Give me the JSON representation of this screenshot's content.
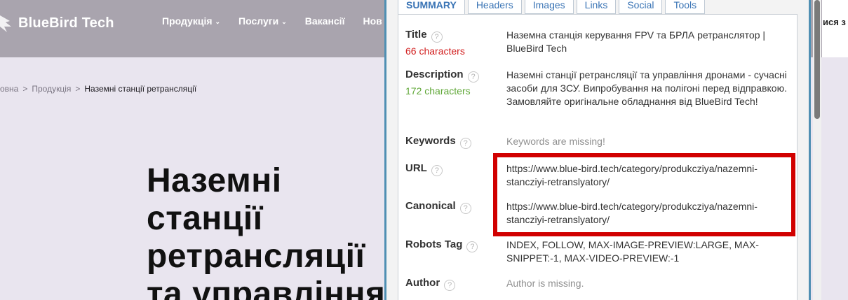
{
  "site": {
    "logo_text": "BlueBird Tech",
    "nav": [
      {
        "label": "Продукція",
        "has_dropdown": true
      },
      {
        "label": "Послуги",
        "has_dropdown": true
      },
      {
        "label": "Вакансії",
        "has_dropdown": false
      },
      {
        "label": "Нов",
        "has_dropdown": false
      }
    ],
    "right_cut_text": "ися з",
    "breadcrumb": {
      "home": "овна",
      "section": "Продукція",
      "current": "Наземні станції ретрансляції",
      "separator": ">"
    },
    "hero_lines": [
      "Наземні",
      "станції",
      "ретрансляції",
      "та управління"
    ]
  },
  "extension": {
    "tabs": [
      "SUMMARY",
      "Headers",
      "Images",
      "Links",
      "Social",
      "Tools"
    ],
    "active_tab": "SUMMARY",
    "rows": {
      "title": {
        "label": "Title",
        "count": "66 characters",
        "value": "Наземна станція керування FPV та БРЛА ретранслятор | BlueBird Tech"
      },
      "description": {
        "label": "Description",
        "count": "172 characters",
        "value": "Наземні станції ретрансляції та управління дронами - сучасні засоби для ЗСУ. Випробування на полігоні перед відправкою. Замовляйте оригінальне обладнання від BlueBird Tech!"
      },
      "keywords": {
        "label": "Keywords",
        "value": "Keywords are missing!"
      },
      "url": {
        "label": "URL",
        "value": "https://www.blue-bird.tech/category/produkcziya/nazemni-stancziyi-retranslyatory/"
      },
      "canonical": {
        "label": "Canonical",
        "value": "https://www.blue-bird.tech/category/produkcziya/nazemni-stancziyi-retranslyatory/"
      },
      "robots": {
        "label": "Robots Tag",
        "value": "INDEX, FOLLOW, MAX-IMAGE-PREVIEW:LARGE, MAX-SNIPPET:-1, MAX-VIDEO-PREVIEW:-1"
      },
      "author": {
        "label": "Author",
        "value": "Author is missing."
      }
    },
    "help_glyph": "?"
  },
  "colors": {
    "header_bg": "#a9a4ae",
    "page_bg": "#e9e5ef",
    "panel_border": "#4f8fb3",
    "tab_text": "#3a74b5",
    "count_red": "#d22020",
    "count_green": "#5fa737",
    "highlight": "#d10000"
  }
}
